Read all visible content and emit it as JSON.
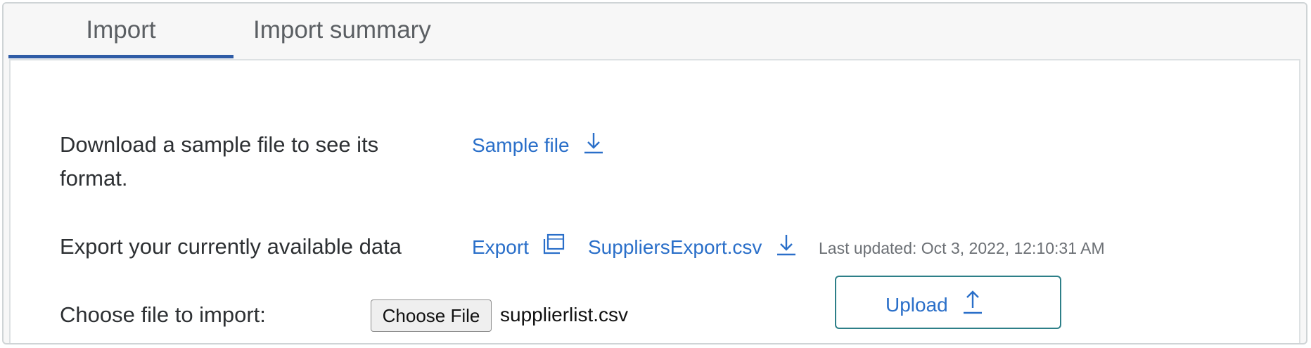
{
  "tabs": [
    {
      "label": "Import",
      "selected": true
    },
    {
      "label": "Import summary",
      "selected": false
    }
  ],
  "sample": {
    "description": "Download a sample file to see its format.",
    "link_label": "Sample file",
    "icon": "download-icon"
  },
  "export": {
    "description": "Export your currently available data",
    "export_label": "Export",
    "export_icon": "copy-icon",
    "file_label": "SuppliersExport.csv",
    "file_icon": "download-icon",
    "last_updated": "Last updated: Oct 3, 2022, 12:10:31 AM"
  },
  "import": {
    "description": "Choose file to import:",
    "choose_label": "Choose File",
    "selected_file": "supplierlist.csv",
    "upload_label": "Upload",
    "upload_icon": "upload-icon"
  },
  "colors": {
    "accent": "#2f5ca6",
    "link": "#2a6fc9",
    "upload_border": "#2d7f88"
  }
}
